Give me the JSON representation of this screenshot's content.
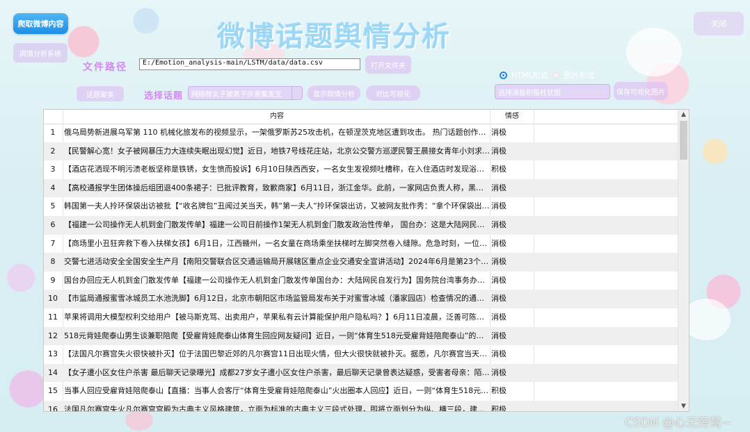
{
  "window": {
    "title": "微博话题舆情分析"
  },
  "buttons": {
    "crawl": "爬取微博内容",
    "system": "舆情分析系统",
    "close": "关闭",
    "open_file": "打开文件夹",
    "cluster": "话题聚类",
    "show_analysis": "显示舆情分析",
    "compare_vis": "对比可视化",
    "save_vis": "保存可视化图片"
  },
  "file": {
    "label": "文件路径",
    "path": "E:/Emotion_analysis-main/LSTM/data/data.csv"
  },
  "topic": {
    "label": "选择话题",
    "placeholder": "网络称女子被男子杀害案发生"
  },
  "display_mode": {
    "options": [
      "HTML形式",
      "图片形式"
    ],
    "selected": "HTML形式"
  },
  "chart_select": {
    "placeholder": "选择消极积极柱状图"
  },
  "table": {
    "headers": {
      "content": "内容",
      "sentiment": "情感"
    },
    "rows": [
      {
        "n": "1",
        "content": "俄乌局势新进展乌军第 110 机械化旅发布的视频显示，一架俄罗斯苏25攻击机，在顿涅茨克地区遭到攻击。 热门话题创作激励...",
        "sentiment": "消极"
      },
      {
        "n": "2",
        "content": "【民警解心宽！女子被网暴压力大连续失眠出现幻觉】近日，地铁7号线花庄站，北京公交警方巡逻民警王晨接女青年小刘求助...",
        "sentiment": "消极"
      },
      {
        "n": "3",
        "content": "【酒店花洒现不明污渍老板坚称是铁锈，女生愤而投诉】6月10日陕西西安，一名女生发视频吐槽称，在入住酒店时发现浴室的...",
        "sentiment": "积极"
      },
      {
        "n": "4",
        "content": "【高校通报学生团体操后组团退400条裙子：已批评教育，致歉商家】6月11日，浙江金华。此前，一家网店负责人称，黑龙江...",
        "sentiment": "消极"
      },
      {
        "n": "5",
        "content": "韩国第一夫人拎环保袋出访被批【“收名牌包”丑闻过关当天，韩“第一夫人”拎环保袋出访，又被网友批作秀：“拿个环保袋出来就...",
        "sentiment": "消极"
      },
      {
        "n": "6",
        "content": "【福建一公司操作无人机到金门散发传单】福建一公司日前操作1架无人机到金门散发政治性传单， 国台办：这是大陆网民表达...",
        "sentiment": "消极"
      },
      {
        "n": "7",
        "content": "【商场里小丑狂奔救下卷入扶梯女孩】6月1日，江西赣州，一名女童在商场乘坐扶梯时左脚突然卷入缝隙。危急时刻，一位“小...",
        "sentiment": "消极"
      },
      {
        "n": "8",
        "content": "交警七进活动安全全国安全生产月【南阳交警联合区交通运输局开展辖区重点企业交通安全宣讲活动】2024年6月是第23个全国“...",
        "sentiment": "消极"
      },
      {
        "n": "9",
        "content": "国台办回应无人机到金门散发传单【福建一公司操作无人机到金门散发传单国台办：大陆网民自发行为】国务院台湾事务办公室...",
        "sentiment": "消极"
      },
      {
        "n": "10",
        "content": "【市监局通报蜜雪冰城员工水池洗脚】6月12日，北京市朝阳区市场监管局发布关于对蜜雪冰城（潘家园店）检查情况的通报。...",
        "sentiment": "消极"
      },
      {
        "n": "11",
        "content": "苹果将调用大模型权利交给用户【被马斯克骂、出卖用户，苹果私有云计算能保护用户隐私吗？】6月11日凌晨，泛善可陈的...",
        "sentiment": "消极"
      },
      {
        "n": "12",
        "content": "518元背娃爬泰山男生谈兼职陪爬【受雇背娃爬泰山体育生回应网友疑问】近日，一则“体育生518元受雇背娃陪爬泰山”的视频...",
        "sentiment": "消极"
      },
      {
        "n": "13",
        "content": "【法国凡尔赛宫失火很快被扑灭】位于法国巴黎近郊的凡尔赛宫11日出现火情，但大火很快就被扑灭。据悉，凡尔赛宫当天拉...",
        "sentiment": "消极"
      },
      {
        "n": "14",
        "content": "【女子遭小区女住户杀害 最后聊天记录曝光】成都27岁女子遭小区女住户杀害，最后聊天记录曾表达疑惑，受害者母亲：陌生...",
        "sentiment": "消极"
      },
      {
        "n": "15",
        "content": "当事人回应受雇背娃陪爬泰山【直播：当事人会客厅“体育生受雇背娃陪爬泰山”火出圈本人回应】近日，一则“体育生518元受雇...",
        "sentiment": "积极"
      },
      {
        "n": "16",
        "content": "法国凡尔赛宫失火凡尔赛宫宫殿为古典主义风格建筑，立面为标准的古典主义三段式处理，即将立面划分为纵、横三段，建筑左...",
        "sentiment": "积极"
      }
    ]
  },
  "watermark": "CSDN @心无旁骛~",
  "colors": {
    "primary_button": "#1d8fe6",
    "label_pink": "#d48af0",
    "title_blue": "#9cd7f5",
    "soft_purple": "#dcbef2"
  }
}
